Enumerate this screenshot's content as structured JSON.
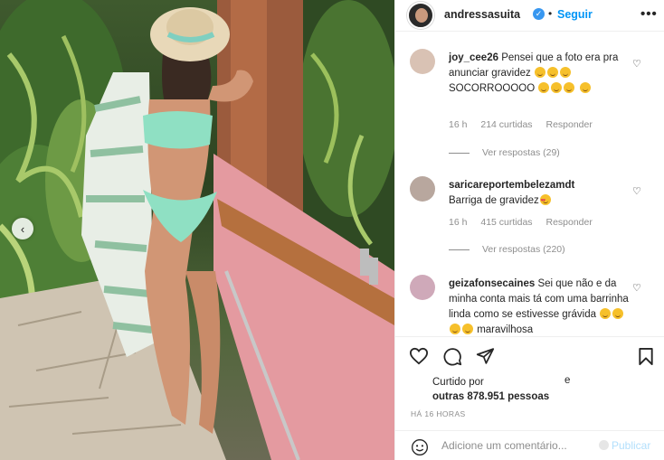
{
  "header": {
    "username": "andressasuita",
    "follow_label": "Seguir",
    "more_label": "•••",
    "verified_icon": "verified-badge-icon"
  },
  "comments": [
    {
      "user": "joy_cee26",
      "text_before": "Pensei que a foto era pra anunciar gravidez",
      "emoji_line1": [
        "grinning-sweat",
        "grinning-sweat",
        "grinning-sweat"
      ],
      "text_after": "SOCORROOOOO",
      "emoji_line2": [
        "grinning-sweat",
        "grinning-sweat",
        "grinning-sweat"
      ],
      "emoji_line3": [
        "grinning-sweat"
      ],
      "time": "16 h",
      "likes": "214 curtidas",
      "reply_label": "Responder",
      "view_replies": "Ver respostas (29)"
    },
    {
      "user": "saricareportembelezamdt",
      "text": "Barriga de gravidez",
      "emoji": [
        "heart-eyes"
      ],
      "time": "16 h",
      "likes": "415 curtidas",
      "reply_label": "Responder",
      "view_replies": "Ver respostas (220)"
    },
    {
      "user": "geizafonsecaines",
      "text": "Sei que não e da minha conta mais tá com uma barrinha linda como se estivesse grávida",
      "emoji": [
        "grimacing",
        "grimacing",
        "grimacing",
        "grimacing"
      ],
      "text_end": "maravilhosa"
    }
  ],
  "likes": {
    "line1": "Curtido por",
    "connector": "e",
    "line2": "outras 878.951 pessoas"
  },
  "timestamp": "HÁ 16 HORAS",
  "add_comment": {
    "placeholder": "Adicione um comentário...",
    "publish_label": "Publicar"
  },
  "colors": {
    "accent": "#0095f6",
    "publish_disabled": "#b2dffc",
    "muted": "#8e8e8e"
  }
}
